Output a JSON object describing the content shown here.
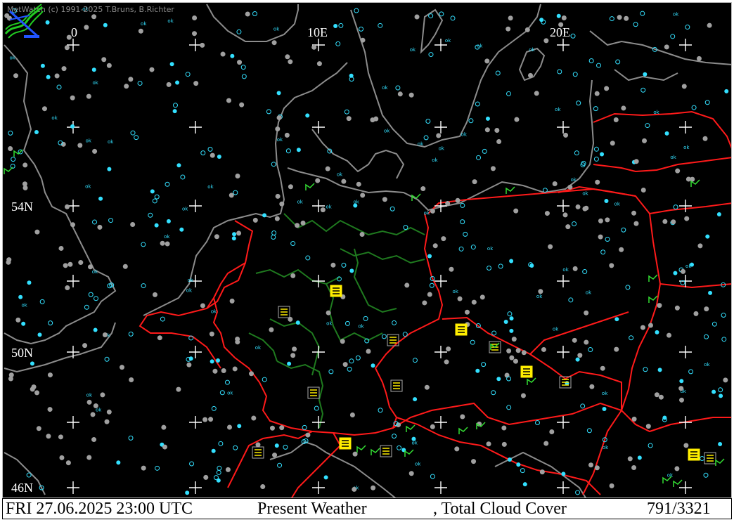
{
  "app": {
    "copyright": "MetWatch  (c) 1991-2025 T.Bruns, B.Richter"
  },
  "map": {
    "longitude_labels": [
      "0",
      "10E",
      "20E"
    ],
    "latitude_labels": [
      "54N",
      "50N",
      "46N"
    ],
    "colors": {
      "background": "#000000",
      "coastline": "#8c8c8c",
      "country_border": "#ff1a1a",
      "state_border": "#1f7a1f",
      "graticule": "#ffffff",
      "station_overcast": "#a0a0a0",
      "station_clear": "#33e0ff",
      "precip_symbol": "#33dd33",
      "fog_symbol": "#ffee00"
    },
    "icons": [
      "metwatch-logo-icon",
      "graticule-cross-icon",
      "station-cloud-cover-icon",
      "present-weather-symbol-icon"
    ]
  },
  "status": {
    "datetime": "FRI 27.06.2025 23:00 UTC",
    "parameter1": "Present Weather",
    "parameter2": ", Total Cloud Cover",
    "count": "791/3321"
  }
}
